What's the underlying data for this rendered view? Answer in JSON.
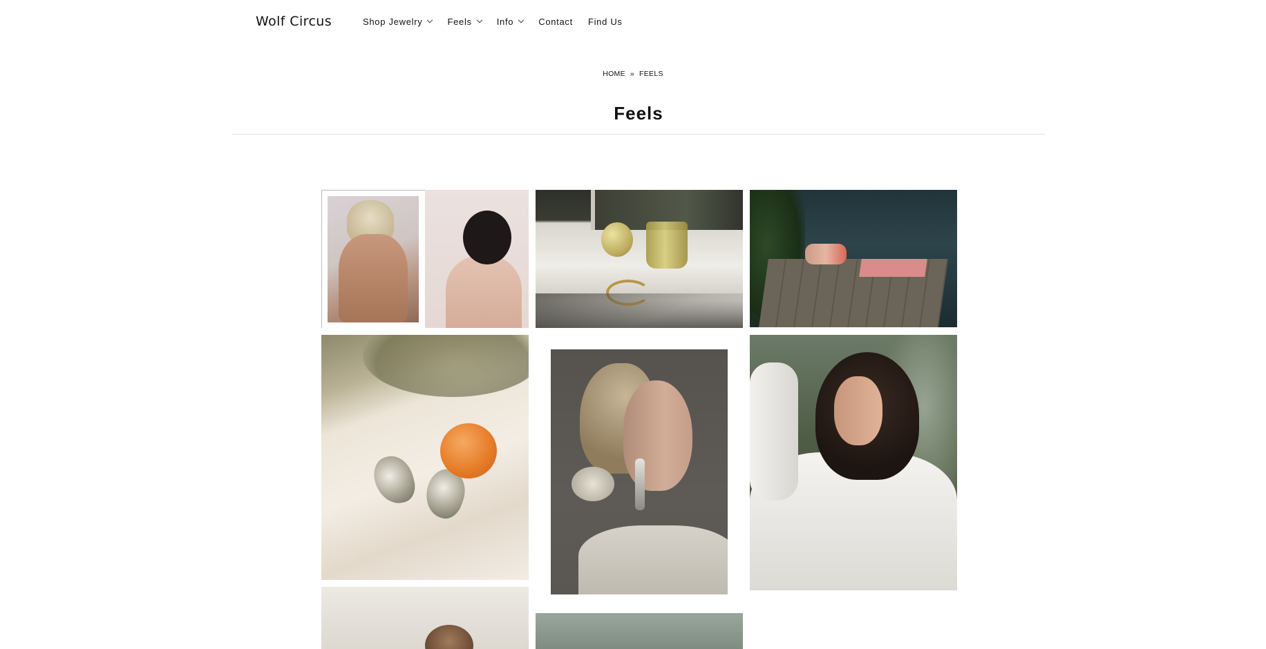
{
  "header": {
    "logo": "Wolf Circus",
    "nav": [
      {
        "label": "Shop Jewelry",
        "has_dropdown": true
      },
      {
        "label": "Feels",
        "has_dropdown": true
      },
      {
        "label": "Info",
        "has_dropdown": true
      },
      {
        "label": "Contact",
        "has_dropdown": false
      },
      {
        "label": "Find Us",
        "has_dropdown": false
      }
    ]
  },
  "breadcrumb": {
    "home": "HOME",
    "separator": "»",
    "current": "FEELS"
  },
  "page": {
    "title": "Feels"
  },
  "gallery": {
    "images": [
      {
        "subject": "diptych of two women, blonde and dark hair, bare shoulders"
      },
      {
        "subject": "still life with lemon, amber glass and gold rings on windowsill"
      },
      {
        "subject": "woman sunbathing on wooden dock by water"
      },
      {
        "subject": "silver wave earrings and apricot on satin fabric"
      },
      {
        "subject": "profile portrait with long silver drop earring and scrunchie"
      },
      {
        "subject": "woman in white blouse with eyes closed, hand on head"
      },
      {
        "subject": "portrait partially visible"
      },
      {
        "subject": "image partially visible"
      }
    ]
  },
  "colors": {
    "text": "#111111",
    "rule": "#e2e2e2",
    "background": "#ffffff"
  }
}
